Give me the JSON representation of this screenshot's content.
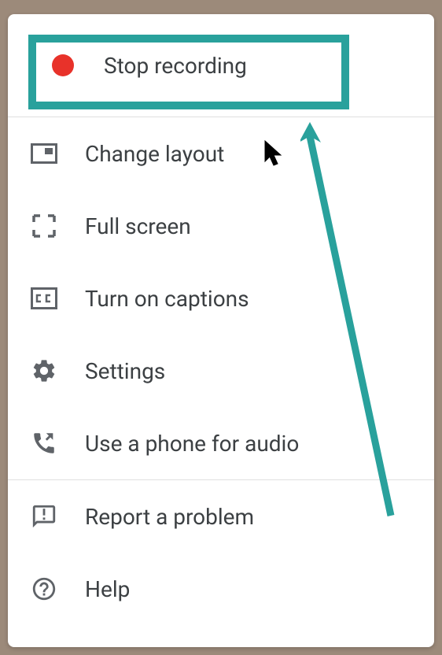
{
  "menu": {
    "stop_recording": {
      "label": "Stop recording",
      "icon": "record-icon"
    },
    "change_layout": {
      "label": "Change layout",
      "icon": "layout-icon"
    },
    "full_screen": {
      "label": "Full screen",
      "icon": "fullscreen-icon"
    },
    "turn_on_captions": {
      "label": "Turn on captions",
      "icon": "captions-icon"
    },
    "settings": {
      "label": "Settings",
      "icon": "gear-icon"
    },
    "use_phone_audio": {
      "label": "Use a phone for audio",
      "icon": "phone-audio-icon"
    },
    "report_problem": {
      "label": "Report a problem",
      "icon": "feedback-icon"
    },
    "help": {
      "label": "Help",
      "icon": "help-icon"
    }
  },
  "colors": {
    "highlight": "#29a19c",
    "record": "#e8322a",
    "icon": "#5f6368",
    "text": "#3c4043"
  }
}
